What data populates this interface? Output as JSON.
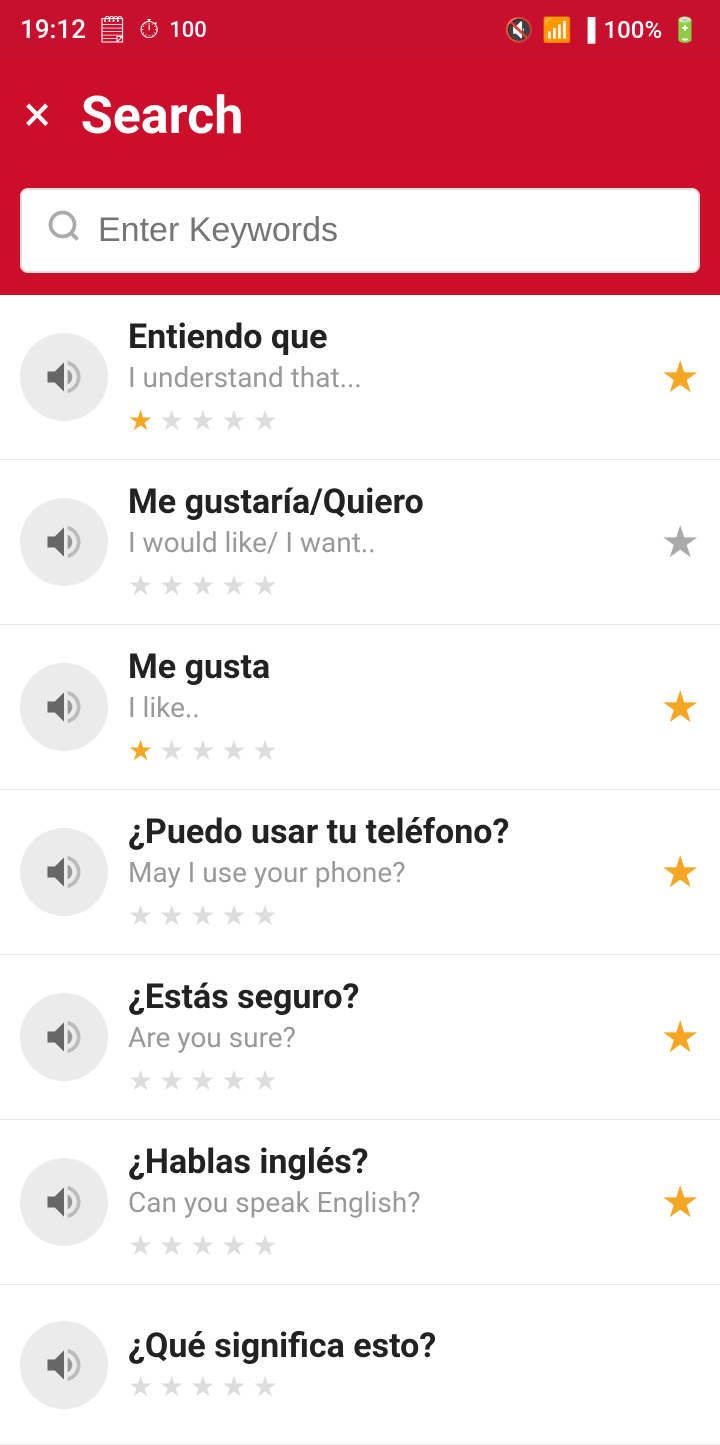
{
  "statusBar": {
    "time": "19:12",
    "battery": "100%"
  },
  "header": {
    "closeLabel": "×",
    "title": "Search"
  },
  "searchBox": {
    "placeholder": "Enter Keywords"
  },
  "items": [
    {
      "id": 1,
      "spanish": "Entiendo que",
      "english": "I understand that...",
      "stars": [
        1,
        0,
        0,
        0,
        0
      ],
      "favorited": true
    },
    {
      "id": 2,
      "spanish": "Me gustaría/Quiero",
      "english": "I would like/ I want..",
      "stars": [
        0,
        0,
        0,
        0,
        0
      ],
      "favorited": false
    },
    {
      "id": 3,
      "spanish": "Me gusta",
      "english": "I like..",
      "stars": [
        1,
        0,
        0,
        0,
        0
      ],
      "favorited": true
    },
    {
      "id": 4,
      "spanish": "¿Puedo usar tu teléfono?",
      "english": "May I use your phone?",
      "stars": [
        0,
        0,
        0,
        0,
        0
      ],
      "favorited": true
    },
    {
      "id": 5,
      "spanish": "¿Estás seguro?",
      "english": "Are you sure?",
      "stars": [
        0,
        0,
        0,
        0,
        0
      ],
      "favorited": true
    },
    {
      "id": 6,
      "spanish": "¿Hablas inglés?",
      "english": "Can you speak English?",
      "stars": [
        0,
        0,
        0,
        0,
        0
      ],
      "favorited": true
    },
    {
      "id": 7,
      "spanish": "¿Qué significa esto?",
      "english": "",
      "stars": [
        0,
        0,
        0,
        0,
        0
      ],
      "favorited": false,
      "partial": true
    }
  ]
}
